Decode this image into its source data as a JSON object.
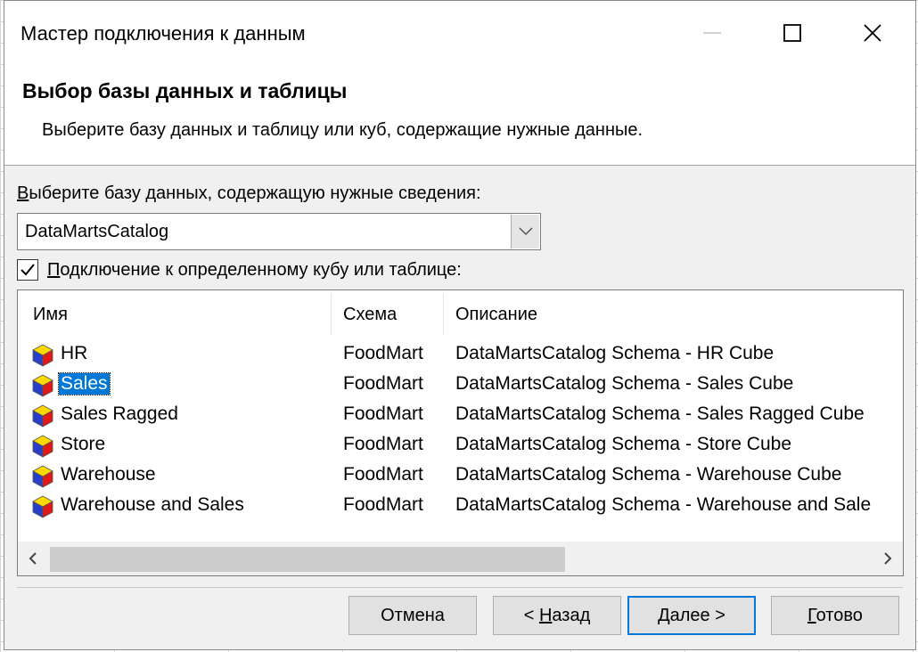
{
  "window": {
    "title": "Мастер подключения к данным"
  },
  "header": {
    "title": "Выбор базы данных и таблицы",
    "subtitle": "Выберите базу данных и таблицу или куб, содержащие нужные данные."
  },
  "database": {
    "label_first": "В",
    "label_rest": "ыберите базу данных, содержащую нужные сведения:",
    "value": "DataMartsCatalog"
  },
  "connect_checkbox": {
    "checked": true,
    "label_first": "П",
    "label_rest": "одключение к определенному кубу или таблице:"
  },
  "table": {
    "columns": [
      "Имя",
      "Схема",
      "Описание"
    ],
    "rows": [
      {
        "name": "HR",
        "schema": "FoodMart",
        "description": "DataMartsCatalog Schema - HR Cube"
      },
      {
        "name": "Sales",
        "schema": "FoodMart",
        "description": "DataMartsCatalog Schema - Sales Cube"
      },
      {
        "name": "Sales Ragged",
        "schema": "FoodMart",
        "description": "DataMartsCatalog Schema - Sales Ragged Cube"
      },
      {
        "name": "Store",
        "schema": "FoodMart",
        "description": "DataMartsCatalog Schema - Store Cube"
      },
      {
        "name": "Warehouse",
        "schema": "FoodMart",
        "description": "DataMartsCatalog Schema - Warehouse Cube"
      },
      {
        "name": "Warehouse and Sales",
        "schema": "FoodMart",
        "description": "DataMartsCatalog Schema - Warehouse and Sale"
      }
    ],
    "selected_row": "Sales"
  },
  "buttons": {
    "cancel": "Отмена",
    "back_prefix": "< ",
    "back_u": "Н",
    "back_rest": "азад",
    "next_u": "Д",
    "next_rest": "алее >",
    "finish_u": "Г",
    "finish_rest": "отово"
  },
  "colors": {
    "selection": "#0078d7",
    "dialog_bg": "#f0f0f0"
  },
  "icons": {
    "row_icon": "cube-icon",
    "window_controls": [
      "minimize-icon",
      "maximize-icon",
      "close-icon"
    ]
  }
}
